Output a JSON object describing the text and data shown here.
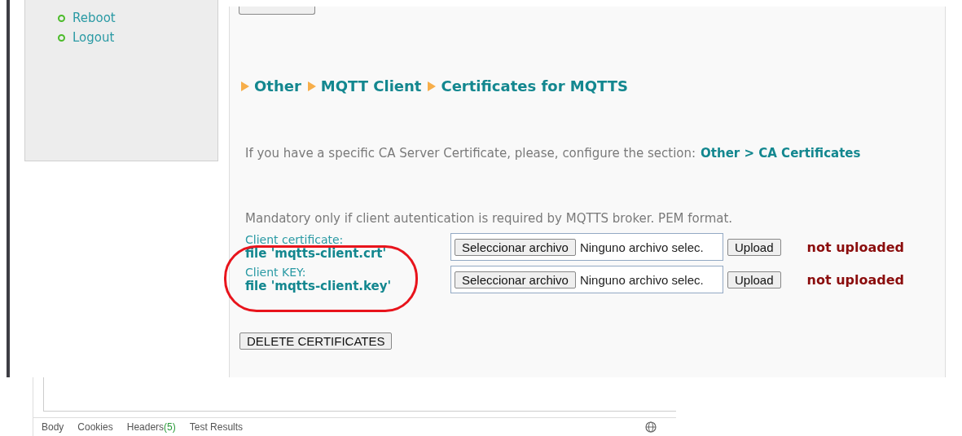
{
  "sidebar": {
    "items": [
      {
        "label": "Reboot"
      },
      {
        "label": "Logout"
      }
    ]
  },
  "main": {
    "breadcrumb": [
      "Other",
      "MQTT Client",
      "Certificates for MQTTS"
    ],
    "ca_note": {
      "text": "If you have a specific CA Server Certificate, please, configure the section:",
      "link": "Other > CA Certificates"
    },
    "mandatory_note": "Mandatory only if client autentication is required by MQTTS broker. PEM format.",
    "certificates": [
      {
        "label": "Client certificate:",
        "file": "file 'mqtts-client.crt'",
        "choose_button": "Seleccionar archivo",
        "file_status": "Ninguno archivo selec.",
        "upload_button": "Upload",
        "status": "not uploaded"
      },
      {
        "label": "Client KEY:",
        "file": "file 'mqtts-client.key'",
        "choose_button": "Seleccionar archivo",
        "file_status": "Ninguno archivo selec.",
        "upload_button": "Upload",
        "status": "not uploaded"
      }
    ],
    "delete_button": "DELETE CERTIFICATES"
  },
  "bottom_panel": {
    "tabs": [
      {
        "label": "Body"
      },
      {
        "label": "Cookies"
      },
      {
        "label": "Headers",
        "count": "(5)"
      },
      {
        "label": "Test Results"
      }
    ]
  }
}
